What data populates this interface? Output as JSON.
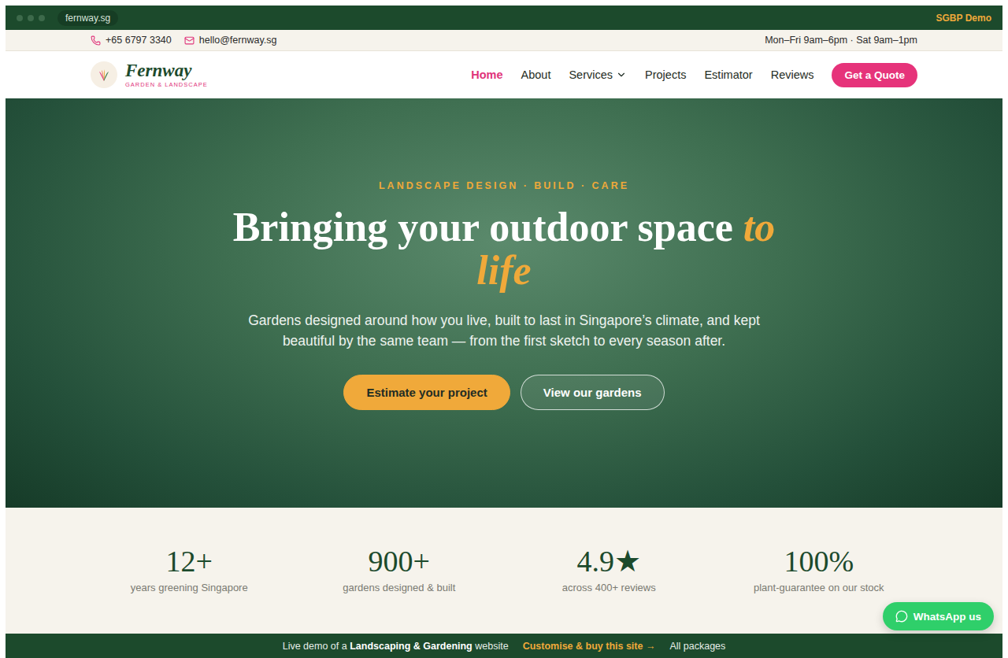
{
  "browser": {
    "url": "fernway.sg",
    "badge": "SGBP Demo"
  },
  "info_bar": {
    "phone": "+65 6797 3340",
    "email": "hello@fernway.sg",
    "hours": "Mon–Fri 9am–6pm · Sat 9am–1pm"
  },
  "nav": {
    "brand": "Fernway",
    "tagline": "GARDEN & LANDSCAPE",
    "items": [
      {
        "label": "Home",
        "selected": true,
        "dropdown": false
      },
      {
        "label": "About",
        "selected": false,
        "dropdown": false
      },
      {
        "label": "Services",
        "selected": false,
        "dropdown": true
      },
      {
        "label": "Projects",
        "selected": false,
        "dropdown": false
      },
      {
        "label": "Estimator",
        "selected": false,
        "dropdown": false
      },
      {
        "label": "Reviews",
        "selected": false,
        "dropdown": false
      }
    ],
    "cta": "Get a Quote"
  },
  "hero": {
    "eyebrow": "LANDSCAPE DESIGN · BUILD · CARE",
    "title": "Bringing your outdoor space",
    "title_accent": "to life",
    "subtitle": "Gardens designed around how you live, built to last in Singapore’s climate, and kept beautiful by the same team — from the first sketch to every season after.",
    "buttons": [
      {
        "label": "Estimate your project",
        "kind": "primary"
      },
      {
        "label": "View our gardens",
        "kind": "outline"
      }
    ]
  },
  "stats": [
    {
      "value": "12+",
      "label": "years greening Singapore"
    },
    {
      "value": "900+",
      "label": "gardens designed & built"
    },
    {
      "value": "4.9★",
      "label": "across 400+ reviews"
    },
    {
      "value": "100%",
      "label": "plant-guarantee on our stock"
    }
  ],
  "whatsapp": "WhatsApp us",
  "demo_bar": {
    "prefix": "Live demo of a",
    "highlight": "Landscaping & Gardening",
    "suffix": "website",
    "cta": "Customise & buy this site →",
    "link": "All packages"
  }
}
